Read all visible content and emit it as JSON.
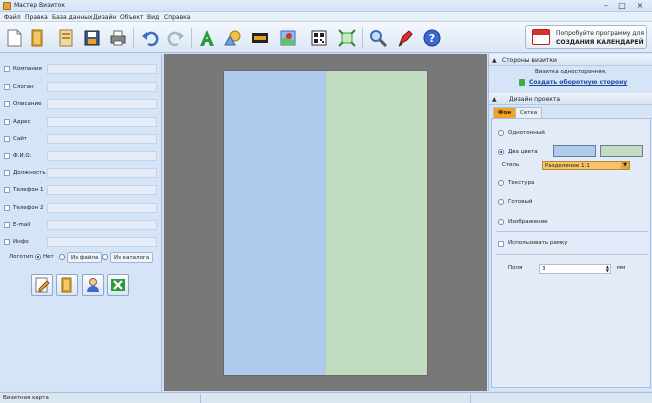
{
  "window": {
    "title": "Мастер Визиток",
    "minimize": "–",
    "maximize": "□",
    "close": "×"
  },
  "menu": [
    "Файл",
    "Правка",
    "База данных",
    "Дизайн",
    "Объект",
    "Вид",
    "Справка"
  ],
  "toolbar": {
    "icons": [
      "new-card-icon",
      "open-icon",
      "templates-icon",
      "save-icon",
      "print-icon",
      "undo-icon",
      "redo-icon",
      "add-text-icon",
      "add-shape-icon",
      "add-image-icon",
      "add-map-icon",
      "add-qr-icon",
      "fit-icon",
      "zoom-icon",
      "pen-icon",
      "help-icon"
    ],
    "promo_line1": "Попробуйте программу для",
    "promo_line2": "СОЗДАНИЯ КАЛЕНДАРЕЙ"
  },
  "fields": [
    "Компания",
    "Слоган",
    "Описание",
    "Адрес",
    "Сайт",
    "Ф.И.О.",
    "Должность",
    "Телефон 1",
    "Телефон 2",
    "E-mail",
    "Инфо"
  ],
  "logo": {
    "label": "Логотип",
    "opt_none": "Нет",
    "opt_file": "Из файла",
    "opt_catalog": "Из каталога"
  },
  "actions": [
    "edit-icon",
    "database-icon",
    "user-icon",
    "excel-icon"
  ],
  "card": {
    "color1": "#aecaec",
    "color2": "#c2dcc2"
  },
  "sides": {
    "header": "Стороны визитки",
    "info": "Визитка односторонняя.",
    "link": "Создать оборотную сторону"
  },
  "design": {
    "header": "Дизайн проекта",
    "tab_bg": "Фон",
    "tab_grid": "Сетка",
    "opt_single": "Однотонный",
    "opt_two": "Два цвета",
    "style_label": "Стиль",
    "style_value": "Разделение 1:1",
    "opt_texture": "Текстура",
    "opt_ready": "Готовый",
    "opt_image": "Изображение",
    "frame_label": "Использовать рамку",
    "margins_label": "Поля",
    "margins_value": "3",
    "margins_unit": "мм"
  },
  "status": {
    "text": "Визитная карта"
  }
}
